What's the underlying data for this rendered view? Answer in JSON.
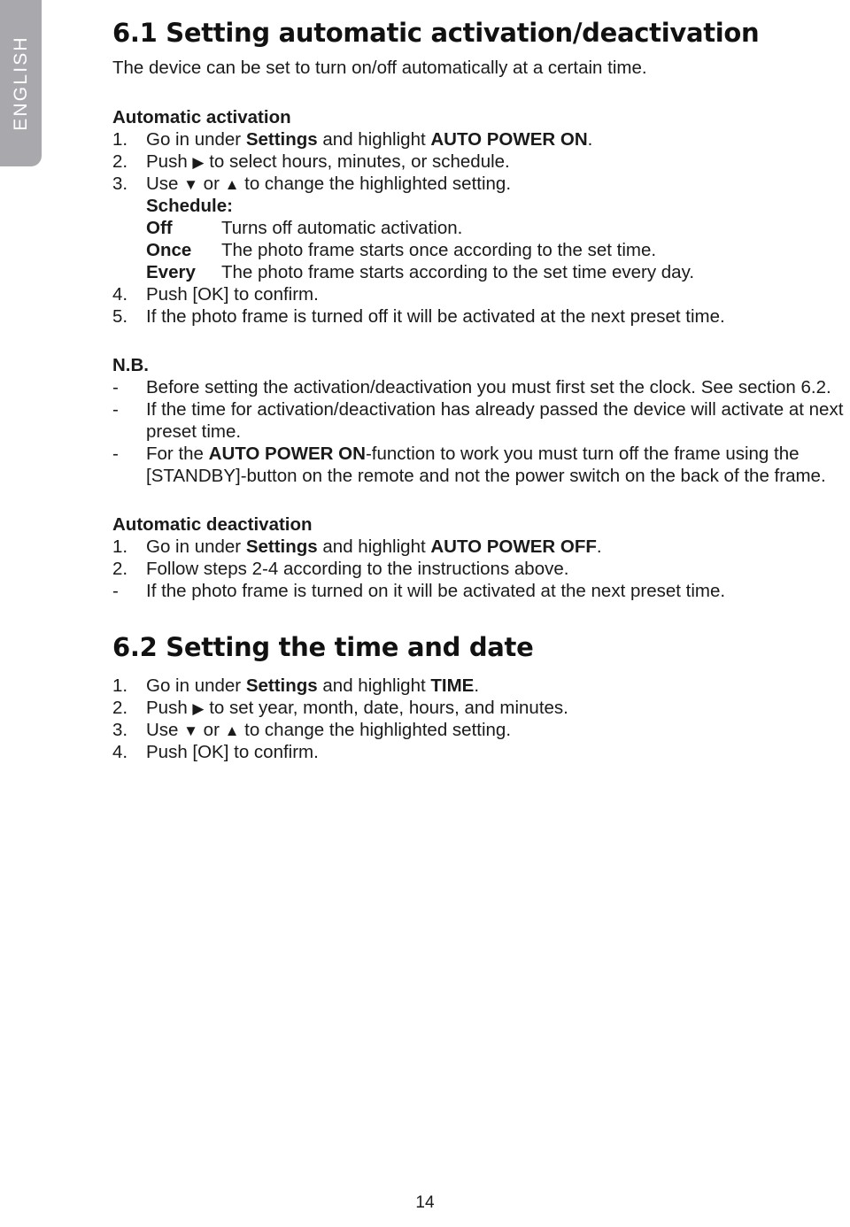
{
  "sidebar": {
    "language_tab": "ENGLISH"
  },
  "page": {
    "number": "14"
  },
  "section_61": {
    "title": "6.1 Setting automatic activation/deactivation",
    "intro": "The device can be set to turn on/off automatically at a certain time.",
    "activation": {
      "heading": "Automatic activation",
      "steps": [
        {
          "marker": "1.",
          "text_before": "Go in under ",
          "bold_1": "Settings",
          "text_mid": " and highlight ",
          "bold_2": "AUTO POWER ON",
          "text_after": "."
        },
        {
          "marker": "2.",
          "text_before": "Push ",
          "glyph": "▶",
          "text_after": " to select hours, minutes, or schedule."
        },
        {
          "marker": "3.",
          "text_before": "Use ",
          "glyph_1": "▼",
          "text_mid": " or ",
          "glyph_2": "▲",
          "text_after": " to change the highlighted setting."
        }
      ],
      "schedule_label": "Schedule:",
      "schedule_options": [
        {
          "term": "Off",
          "desc": "Turns off automatic activation."
        },
        {
          "term": "Once",
          "desc": "The photo frame starts once according to the set time."
        },
        {
          "term": "Every",
          "desc": "The photo frame starts according to the set time every day."
        }
      ],
      "steps_cont": [
        {
          "marker": "4.",
          "text": "Push [OK] to confirm."
        },
        {
          "marker": "5.",
          "text": "If the photo frame is turned off it will be activated at the next preset time."
        }
      ]
    },
    "nb": {
      "label": "N.B.",
      "items": [
        {
          "marker": "-",
          "text": "Before setting the activation/deactivation you must first set the clock. See section 6.2."
        },
        {
          "marker": "-",
          "text": "If the time for activation/deactivation has already passed the device will activate at next preset time."
        },
        {
          "marker": "-",
          "text_before": "For the ",
          "bold_1": "AUTO POWER ON",
          "text_after": "-function to work you must turn off the frame using the [STANDBY]-button on the remote and not the power switch on the back of the frame."
        }
      ]
    },
    "deactivation": {
      "heading": "Automatic deactivation",
      "steps": [
        {
          "marker": "1.",
          "text_before": "Go in under ",
          "bold_1": "Settings",
          "text_mid": " and highlight ",
          "bold_2": "AUTO POWER OFF",
          "text_after": "."
        },
        {
          "marker": "2.",
          "text": "Follow steps 2-4 according to the instructions above."
        },
        {
          "marker": "-",
          "text": "If the photo frame is turned on it will be activated at the next preset time."
        }
      ]
    }
  },
  "section_62": {
    "title": "6.2 Setting the time and date",
    "steps": [
      {
        "marker": "1.",
        "text_before": "Go in under ",
        "bold_1": "Settings",
        "text_mid": " and highlight ",
        "bold_2": "TIME",
        "text_after": "."
      },
      {
        "marker": "2.",
        "text_before": "Push ",
        "glyph": "▶",
        "text_after": " to set year, month, date, hours, and minutes."
      },
      {
        "marker": "3.",
        "text_before": "Use ",
        "glyph_1": "▼",
        "text_mid": " or ",
        "glyph_2": "▲",
        "text_after": " to change the highlighted setting."
      },
      {
        "marker": "4.",
        "text": "Push [OK] to confirm."
      }
    ]
  }
}
